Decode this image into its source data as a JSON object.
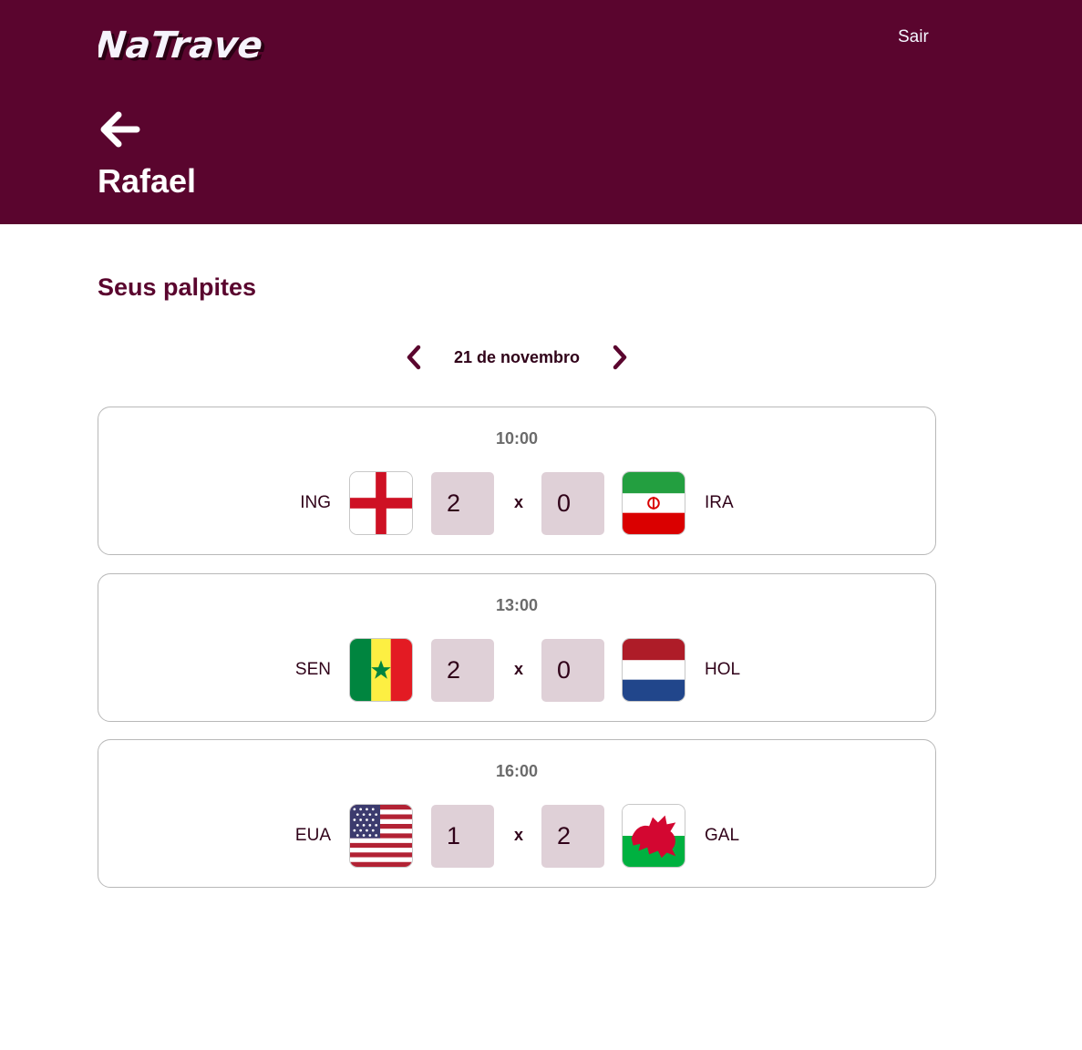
{
  "header": {
    "logo_text": "NaTrave",
    "logout_label": "Sair",
    "user_name": "Rafael"
  },
  "colors": {
    "brand": "#5a052e",
    "score_bg": "#dfd0d7",
    "text_dark": "#300219"
  },
  "main": {
    "title": "Seus palpites",
    "date_label": "21 de novembro",
    "icons": {
      "back": "arrow-left-icon",
      "prev": "chevron-left-icon",
      "next": "chevron-right-icon"
    },
    "games": [
      {
        "time": "10:00",
        "home_team": "ING",
        "home_flag": "england-flag-icon",
        "home_score": "2",
        "separator": "x",
        "away_score": "0",
        "away_team": "IRA",
        "away_flag": "iran-flag-icon"
      },
      {
        "time": "13:00",
        "home_team": "SEN",
        "home_flag": "senegal-flag-icon",
        "home_score": "2",
        "separator": "x",
        "away_score": "0",
        "away_team": "HOL",
        "away_flag": "netherlands-flag-icon"
      },
      {
        "time": "16:00",
        "home_team": "EUA",
        "home_flag": "usa-flag-icon",
        "home_score": "1",
        "separator": "x",
        "away_score": "2",
        "away_team": "GAL",
        "away_flag": "wales-flag-icon"
      }
    ]
  }
}
